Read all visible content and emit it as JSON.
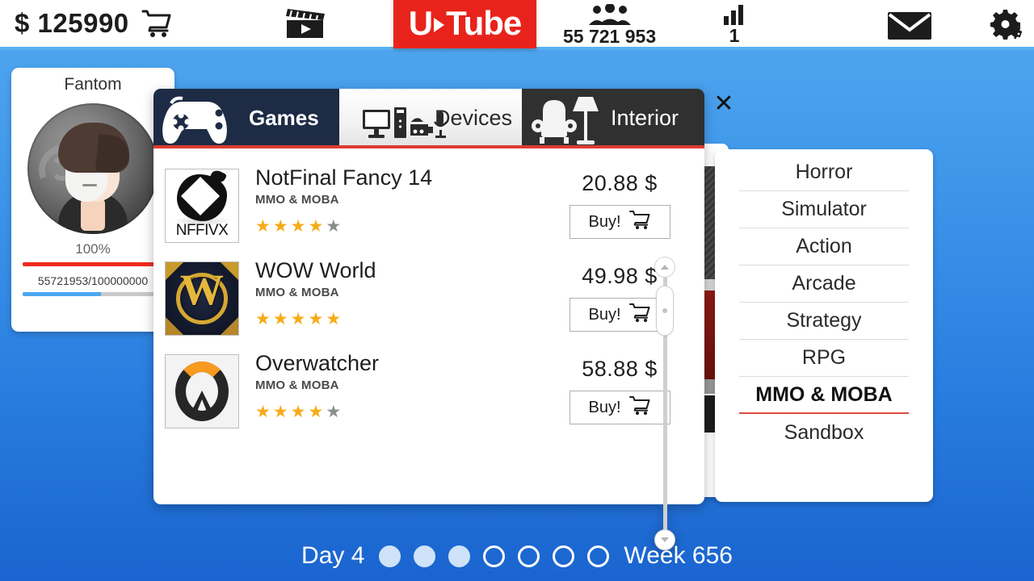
{
  "topbar": {
    "money_symbol": "$",
    "money": "125990",
    "cart_icon": "shopping-cart-icon",
    "clapper_icon": "movie-clapper-icon",
    "logo_part1": "U",
    "logo_part2": "Tube",
    "subscribers": "55 721 953",
    "subscribers_icon": "people-group-icon",
    "level": "1",
    "level_icon": "bar-chart-icon",
    "mail_icon": "envelope-icon",
    "settings_icon": "gears-icon"
  },
  "profile": {
    "name": "Fantom",
    "avatar_icon": "avatar-portrait",
    "health_percent_label": "100%",
    "health_percent": 100,
    "xp_label": "55721953/100000000",
    "xp_percent": 55.7
  },
  "store": {
    "close_label": "✕",
    "tabs": [
      {
        "label": "Games",
        "icon": "gamepad-icon",
        "active": true
      },
      {
        "label": "Devices",
        "icon": "devices-icon",
        "active": false
      },
      {
        "label": "Interior",
        "icon": "armchair-lamp-icon",
        "active": false
      }
    ],
    "buy_label": "Buy!",
    "buy_icon": "shopping-cart-icon",
    "items": [
      {
        "title": "NotFinal Fancy 14",
        "genre": "MMO & MOBA",
        "rating": 4,
        "max_rating": 5,
        "price": "20.88 $",
        "icon": "nffivx-logo",
        "icon_text": "NFFIVX"
      },
      {
        "title": "WOW World",
        "genre": "MMO & MOBA",
        "rating": 5,
        "max_rating": 5,
        "price": "49.98 $",
        "icon": "wow-logo",
        "icon_text": "W"
      },
      {
        "title": "Overwatcher",
        "genre": "MMO & MOBA",
        "rating": 4,
        "max_rating": 5,
        "price": "58.88 $",
        "icon": "overwatcher-logo",
        "icon_text": ""
      }
    ],
    "scrollbar": {
      "up_icon": "chevron-up-icon",
      "down_icon": "chevron-down-icon",
      "thumb_position_percent": 4
    }
  },
  "categories": {
    "items": [
      {
        "label": "Horror",
        "active": false
      },
      {
        "label": "Simulator",
        "active": false
      },
      {
        "label": "Action",
        "active": false
      },
      {
        "label": "Arcade",
        "active": false
      },
      {
        "label": "Strategy",
        "active": false
      },
      {
        "label": "RPG",
        "active": false
      },
      {
        "label": "MMO & MOBA",
        "active": true
      },
      {
        "label": "Sandbox",
        "active": false
      }
    ]
  },
  "bottombar": {
    "day_label": "Day 4",
    "week_label": "Week 656",
    "dots_total": 7,
    "dots_filled": 3
  },
  "colors": {
    "background_top": "#53a9ef",
    "background_bottom": "#1a64cf",
    "logo_red": "#e8231b",
    "accent_red": "#e03a30",
    "star_gold": "#f6ab18",
    "star_gray": "#8c8c8c",
    "tab_active_navy": "#1d2b45",
    "xp_blue": "#4aa8f0"
  }
}
